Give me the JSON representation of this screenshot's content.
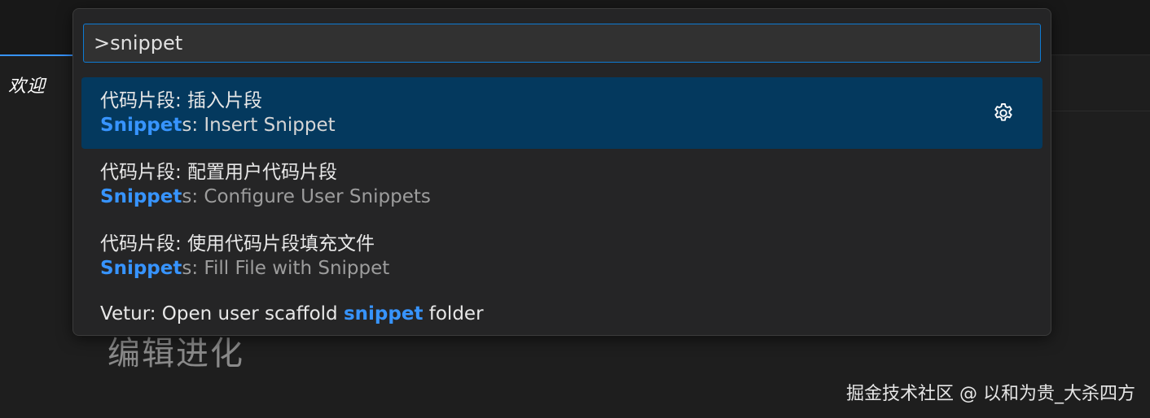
{
  "background": {
    "tab_label": "欢迎",
    "heading": "编辑进化",
    "watermark": "掘金技术社区 @ 以和为贵_大杀四方"
  },
  "quick_pick": {
    "input_value": ">snippet",
    "items": [
      {
        "label": "代码片段: 插入片段",
        "detail_match": "Snippet",
        "detail_rest": "s: Insert Snippet",
        "selected": true,
        "action_icon": "gear-icon"
      },
      {
        "label": "代码片段: 配置用户代码片段",
        "detail_match": "Snippet",
        "detail_rest": "s: Configure User Snippets",
        "selected": false
      },
      {
        "label": "代码片段: 使用代码片段填充文件",
        "detail_match": "Snippet",
        "detail_rest": "s: Fill File with Snippet",
        "selected": false
      },
      {
        "label_prefix": "Vetur: Open user scaffold ",
        "label_match": "snippet",
        "label_suffix": " folder",
        "selected": false
      }
    ]
  },
  "colors": {
    "accent": "#3794ff",
    "selection": "#04395e",
    "focus_border": "#0e7bd4"
  }
}
